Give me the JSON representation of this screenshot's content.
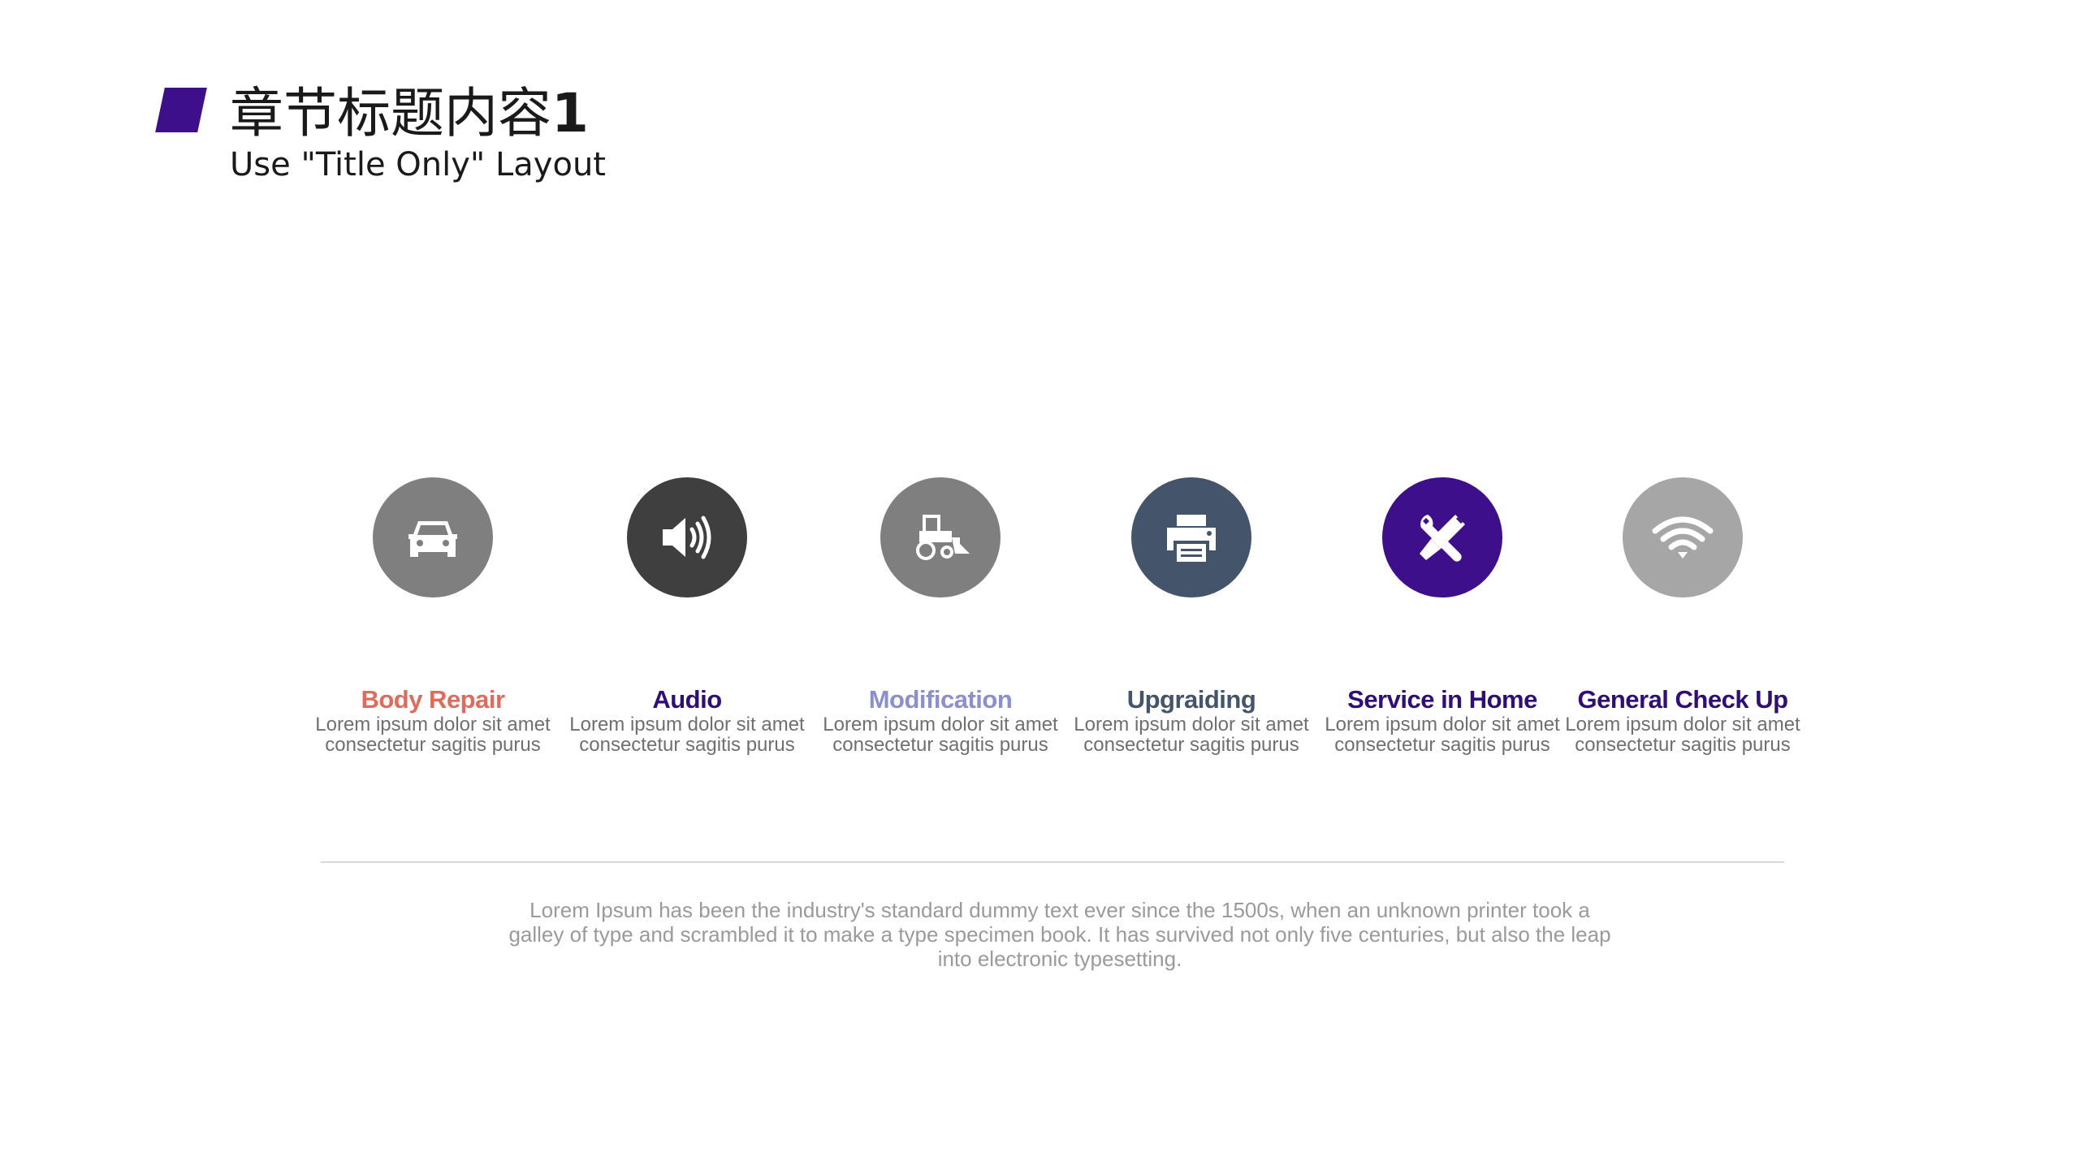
{
  "header": {
    "title_text": "章节标题内容",
    "title_number": "1",
    "subtitle": "Use \"Title Only\" Layout"
  },
  "services": [
    {
      "label": "Body Repair",
      "description": "Lorem ipsum dolor sit amet consectetur sagitis purus",
      "icon": "car-icon",
      "circle_color": "#7f7f7f",
      "label_color": "#e06b5b"
    },
    {
      "label": "Audio",
      "description": "Lorem ipsum dolor sit amet consectetur sagitis purus",
      "icon": "speaker-icon",
      "circle_color": "#3f3f3f",
      "label_color": "#2f0d7a"
    },
    {
      "label": "Modification",
      "description": "Lorem ipsum dolor sit amet consectetur sagitis purus",
      "icon": "bulldozer-icon",
      "circle_color": "#7f7f7f",
      "label_color": "#8a8fcf"
    },
    {
      "label": "Upgraiding",
      "description": "Lorem ipsum dolor sit amet consectetur sagitis purus",
      "icon": "printer-icon",
      "circle_color": "#44546a",
      "label_color": "#44546a"
    },
    {
      "label": "Service in Home",
      "description": "Lorem ipsum dolor sit amet consectetur sagitis purus",
      "icon": "tools-icon",
      "circle_color": "#3d0f8a",
      "label_color": "#2f0d7a"
    },
    {
      "label": "General Check Up",
      "description": "Lorem ipsum dolor sit amet consectetur sagitis purus",
      "icon": "wifi-icon",
      "circle_color": "#a6a6a6",
      "label_color": "#2f0d7a"
    }
  ],
  "footer": {
    "text": "Lorem Ipsum has been the industry's standard dummy text ever since the 1500s, when an unknown printer took a galley of type and scrambled it to make a type specimen book. It has survived not only five centuries, but also the leap into electronic typesetting."
  }
}
